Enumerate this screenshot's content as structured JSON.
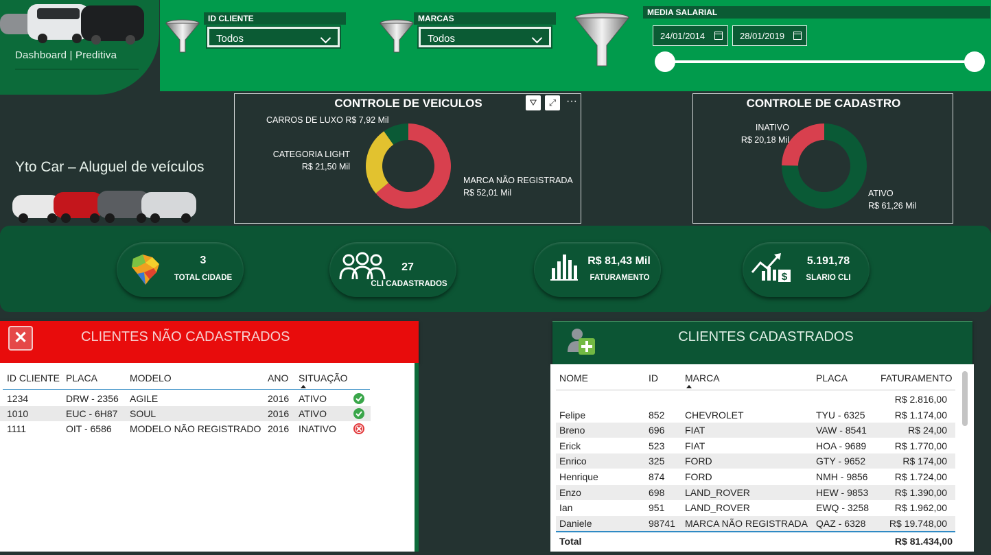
{
  "app": {
    "logo_title": "Dashboard | Preditiva",
    "brand": "Yto Car – Aluguel de veículos"
  },
  "filters": {
    "id_cliente": {
      "label": "ID CLIENTE",
      "value": "Todos"
    },
    "marcas": {
      "label": "MARCAS",
      "value": "Todos"
    },
    "media_salarial": {
      "label": "MEDIA SALARIAL",
      "date_start": "24/01/2014",
      "date_end": "28/01/2019",
      "slider_start": 0,
      "slider_end": 1
    }
  },
  "controle_veiculos": {
    "title": "CONTROLE DE VEICULOS",
    "chart_data": {
      "type": "pie",
      "donut": true,
      "slices": [
        {
          "name": "MARCA NÃO REGISTRADA",
          "value_label": "R$ 52,01 Mil",
          "value": 52.01,
          "color": "#d8404e"
        },
        {
          "name": "CATEGORIA LIGHT",
          "value_label": "R$ 21,50 Mil",
          "value": 21.5,
          "color": "#e2c22f"
        },
        {
          "name": "CARROS DE LUXO",
          "value_label": "R$ 7,92 Mil",
          "value": 7.92,
          "color": "#0a5a36"
        }
      ]
    }
  },
  "controle_cadastro": {
    "title": "CONTROLE DE CADASTRO",
    "chart_data": {
      "type": "pie",
      "donut": true,
      "slices": [
        {
          "name": "ATIVO",
          "value_label": "R$ 61,26 Mil",
          "value": 61.26,
          "color": "#0a5a36"
        },
        {
          "name": "INATIVO",
          "value_label": "R$ 20,18 Mil",
          "value": 20.18,
          "color": "#d8404e"
        }
      ]
    }
  },
  "kpis": [
    {
      "value": "3",
      "label": "TOTAL CIDADE",
      "icon": "brazil-map-icon"
    },
    {
      "value": "27",
      "label": "CLI CADASTRADOS",
      "icon": "people-icon"
    },
    {
      "value": "R$ 81,43 Mil",
      "label": "FATURAMENTO",
      "icon": "bar-chart-icon"
    },
    {
      "value": "5.191,78",
      "label": "SLARIO CLI",
      "icon": "salary-growth-icon"
    }
  ],
  "nao_cadastrados": {
    "title": "CLIENTES NÃO CADASTRADOS",
    "columns": [
      "ID CLIENTE",
      "PLACA",
      "MODELO",
      "ANO",
      "SITUAÇÃO"
    ],
    "rows": [
      {
        "id": "1234",
        "placa": "DRW - 2356",
        "modelo": "AGILE",
        "ano": "2016",
        "situacao": "ATIVO",
        "status": "ok"
      },
      {
        "id": "1010",
        "placa": "EUC - 6H87",
        "modelo": "SOUL",
        "ano": "2016",
        "situacao": "ATIVO",
        "status": "ok"
      },
      {
        "id": "1111",
        "placa": "OIT - 6586",
        "modelo": "MODELO NÃO REGISTRADO",
        "ano": "2016",
        "situacao": "INATIVO",
        "status": "error"
      }
    ]
  },
  "cadastrados": {
    "title": "CLIENTES CADASTRADOS",
    "columns": [
      "NOME",
      "ID",
      "MARCA",
      "PLACA",
      "FATURAMENTO"
    ],
    "rows": [
      {
        "nome": "",
        "id": "",
        "marca": "",
        "placa": "",
        "fat": "R$ 2.816,00"
      },
      {
        "nome": "Felipe",
        "id": "852",
        "marca": "CHEVROLET",
        "placa": "TYU - 6325",
        "fat": "R$ 1.174,00"
      },
      {
        "nome": "Breno",
        "id": "696",
        "marca": "FIAT",
        "placa": "VAW - 8541",
        "fat": "R$ 24,00"
      },
      {
        "nome": "Erick",
        "id": "523",
        "marca": "FIAT",
        "placa": "HOA - 9689",
        "fat": "R$ 1.770,00"
      },
      {
        "nome": "Enrico",
        "id": "325",
        "marca": "FORD",
        "placa": "GTY - 9652",
        "fat": "R$ 174,00"
      },
      {
        "nome": "Henrique",
        "id": "874",
        "marca": "FORD",
        "placa": "NMH - 9856",
        "fat": "R$ 1.724,00"
      },
      {
        "nome": "Enzo",
        "id": "698",
        "marca": "LAND_ROVER",
        "placa": "HEW - 9853",
        "fat": "R$ 1.390,00"
      },
      {
        "nome": "Ian",
        "id": "951",
        "marca": "LAND_ROVER",
        "placa": "EWQ - 3258",
        "fat": "R$ 1.962,00"
      },
      {
        "nome": "Daniele",
        "id": "98741",
        "marca": "MARCA NÃO REGISTRADA",
        "placa": "QAZ - 6328",
        "fat": "R$ 19.748,00"
      }
    ],
    "total_label": "Total",
    "total_value": "R$ 81.434,00"
  },
  "colors": {
    "bg": "#243331",
    "green": "#019b4c",
    "dark_green": "#0c5534",
    "red": "#e80c0c"
  }
}
